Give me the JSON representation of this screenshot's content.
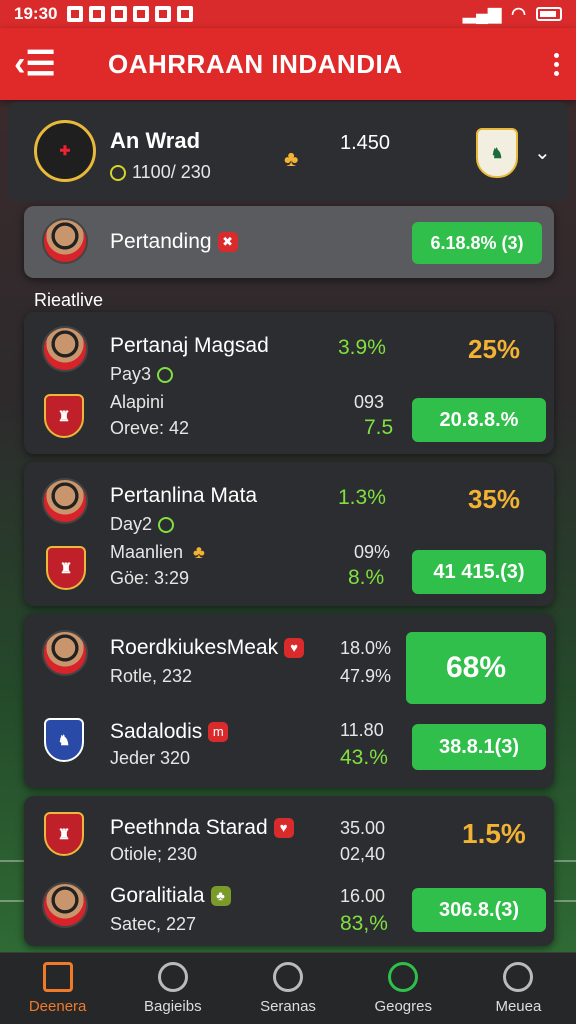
{
  "status_bar": {
    "time": "19:30"
  },
  "header": {
    "title": "OAHRRAAN INDANDIA",
    "back_icon": "back-arrow-icon",
    "menu_icon": "more-vert-icon"
  },
  "colors": {
    "header": "#e02a2a",
    "accent_green": "#2fbf4a",
    "gold": "#f2b233",
    "active_nav": "#f07a2a"
  },
  "match": {
    "team": "An Wrad",
    "sub": "1100/ 230",
    "score": "1.450"
  },
  "featured": {
    "label": "Pertanding",
    "value": "6.18.8% (3)"
  },
  "section_label": "Rieatlive",
  "cards": [
    {
      "p1": {
        "name": "Pertanaj Magsad",
        "sub": "Pay3",
        "pct": "3.9%",
        "big": "25%"
      },
      "p2": {
        "name": "Alapini",
        "sub": "Oreve: 42",
        "v1": "093",
        "v2": "7.5",
        "pill": "20.8.8.%"
      }
    },
    {
      "p1": {
        "name": "Pertanlina Mata",
        "sub": "Day2",
        "pct": "1.3%",
        "big": "35%"
      },
      "p2": {
        "name": "Maanlien",
        "sub": "Göe: 3:29",
        "v1": "09%",
        "v2": "8.%",
        "pill": "41 415.(3)"
      }
    },
    {
      "p1": {
        "name": "RoerdkiukesMeak",
        "sub": "Rotle, 232",
        "v1": "18.0%",
        "v2": "47.9%",
        "big": "68%"
      },
      "p2": {
        "name": "Sadalodis",
        "sub": "Jeder 320",
        "v1": "11.80",
        "v2": "43.%",
        "pill": "38.8.1(3)"
      }
    },
    {
      "p1": {
        "name": "Peethnda Starad",
        "sub": "Otiole; 230",
        "v1": "35.00",
        "v2": "02,40",
        "big": "1.5%"
      },
      "p2": {
        "name": "Goralitiala",
        "sub": "Satec, 227",
        "v1": "16.00",
        "v2": "83,%",
        "pill": "306.8.(3)"
      }
    }
  ],
  "nav": [
    {
      "label": "Deenera",
      "icon": "home-icon"
    },
    {
      "label": "Bagieibs",
      "icon": "compass-icon"
    },
    {
      "label": "Seranas",
      "icon": "profile-icon"
    },
    {
      "label": "Geogres",
      "icon": "globe-icon"
    },
    {
      "label": "Meuea",
      "icon": "person-icon"
    }
  ]
}
